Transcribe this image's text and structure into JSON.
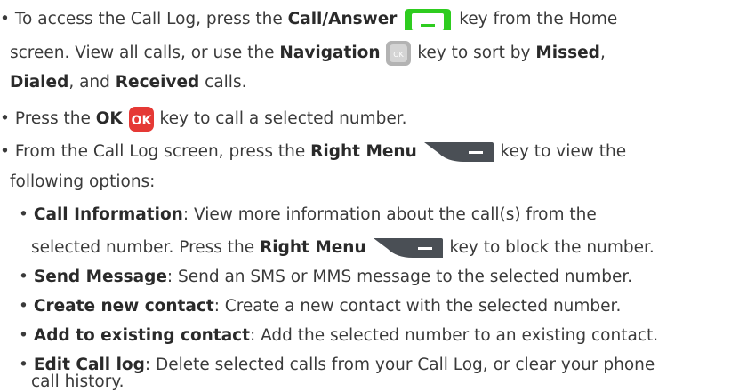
{
  "colors": {
    "green": "#2ecc1f",
    "nav": "#b3b3b3",
    "ok": "#e53935",
    "menu": "#4a4f55"
  },
  "b1": {
    "t1": "To access the Call Log, press the ",
    "k_call": "Call/Answer",
    "t2": " key from the Home",
    "t3": "screen. View all calls, or use the ",
    "k_nav": "Navigation",
    "nav_glyph": "OK",
    "t4": " key to sort by ",
    "missed": "Missed",
    "comma": ",",
    "dialed": "Dialed",
    "t5": ", and ",
    "received": "Received",
    "t6": " calls."
  },
  "b2": {
    "t1": "Press the ",
    "k_ok": "OK",
    "ok_glyph": "OK",
    "t2": " key to call a selected number."
  },
  "b3": {
    "t1": "From the Call Log screen, press the ",
    "k_rm": "Right Menu",
    "t2": " key to view the",
    "t3": "following options:"
  },
  "sub": {
    "ci_label": "Call Information",
    "ci_t1": ": View more information about the call(s) from the",
    "ci_t2": "selected number. Press the ",
    "ci_k": "Right Menu",
    "ci_t3": " key to block the number.",
    "sm_label": "Send Message",
    "sm_text": ": Send an SMS or MMS message to the selected number.",
    "cnc_label": "Create new contact",
    "cnc_text": ": Create a new contact with the selected number.",
    "aec_label": "Add to existing contact",
    "aec_text": ": Add the selected number to an existing contact.",
    "ecl_label": "Edit Call log",
    "ecl_text": ": Delete selected calls from your Call Log, or clear your phone",
    "ecl_text2": "call history."
  },
  "bullet_char": "•"
}
